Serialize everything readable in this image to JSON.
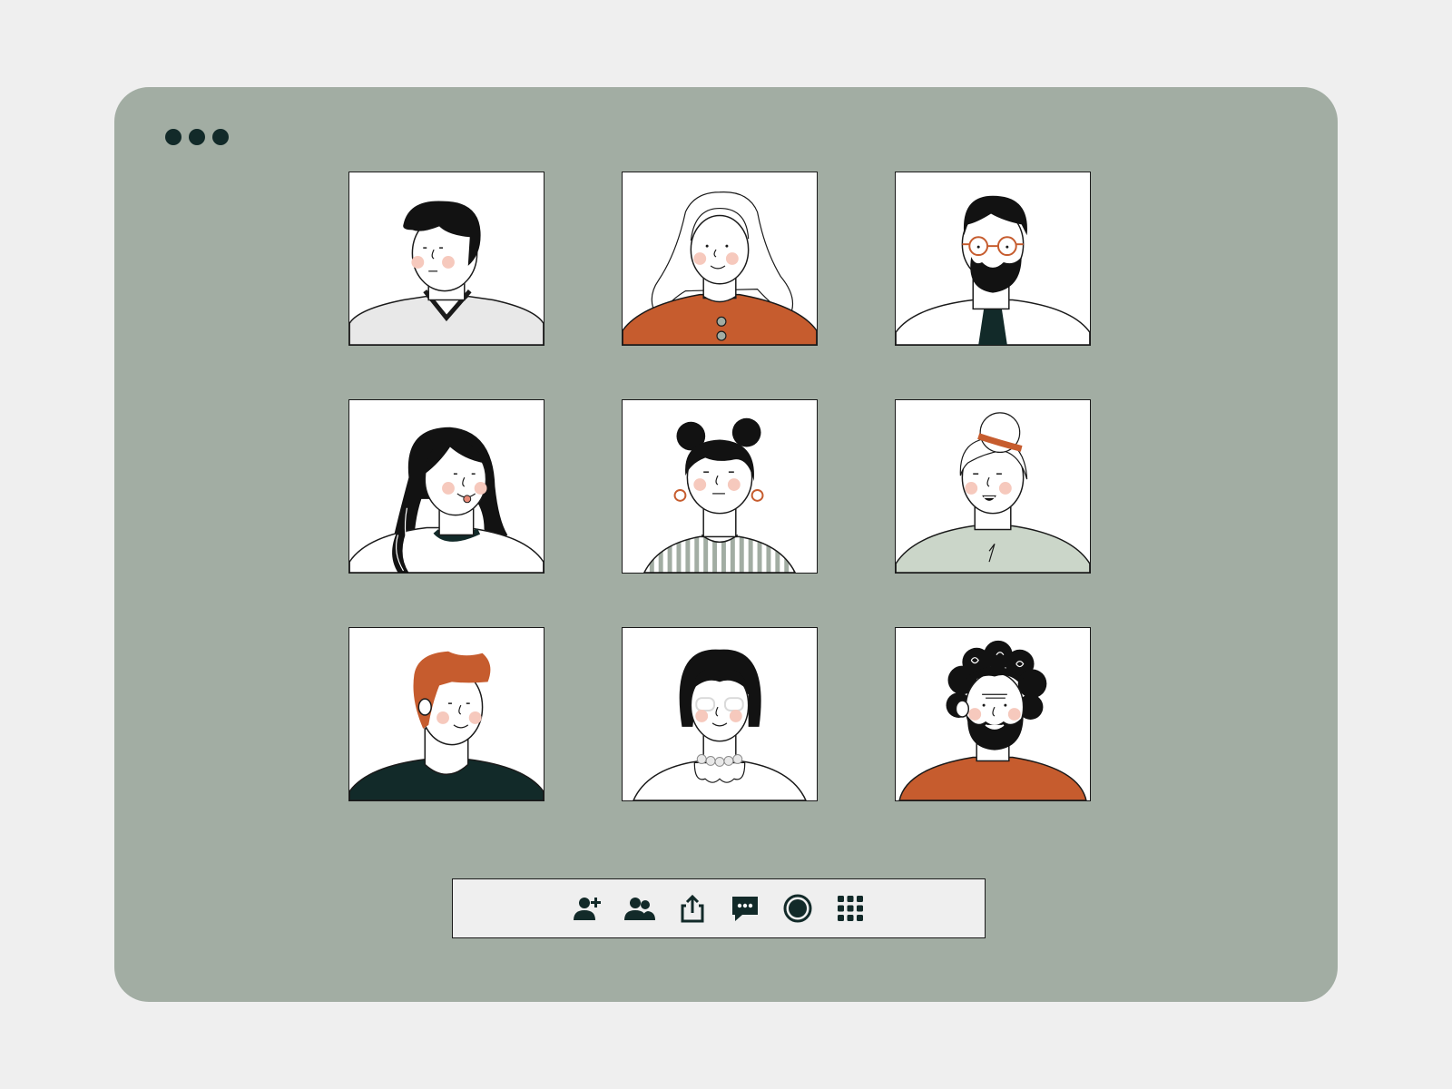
{
  "window": {
    "background": "#a2ada3",
    "control_dots": 3
  },
  "participants": [
    {
      "id": "p1",
      "avatar": "man-black-hair-grey-sweater"
    },
    {
      "id": "p2",
      "avatar": "woman-grey-wavy-hair-orange-top"
    },
    {
      "id": "p3",
      "avatar": "man-beard-glasses-tie"
    },
    {
      "id": "p4",
      "avatar": "woman-long-black-hair-tongue-out"
    },
    {
      "id": "p5",
      "avatar": "woman-double-bun-earrings-striped-top"
    },
    {
      "id": "p6",
      "avatar": "elderly-woman-bun-headband"
    },
    {
      "id": "p7",
      "avatar": "man-orange-hair-dark-shirt"
    },
    {
      "id": "p8",
      "avatar": "woman-bob-glasses-pearl-necklace"
    },
    {
      "id": "p9",
      "avatar": "man-curly-hair-beard-orange-sweater"
    }
  ],
  "toolbar": {
    "buttons": [
      {
        "icon": "add-person-icon"
      },
      {
        "icon": "participants-icon"
      },
      {
        "icon": "share-icon"
      },
      {
        "icon": "chat-icon"
      },
      {
        "icon": "record-icon"
      },
      {
        "icon": "apps-grid-icon"
      }
    ]
  },
  "colors": {
    "dark": "#122a29",
    "accent_orange": "#c65c2e",
    "sage": "#cbd6c9",
    "cheek": "#f6c9bd",
    "toolbar_bg": "#efefef",
    "page_bg": "#efefef"
  }
}
